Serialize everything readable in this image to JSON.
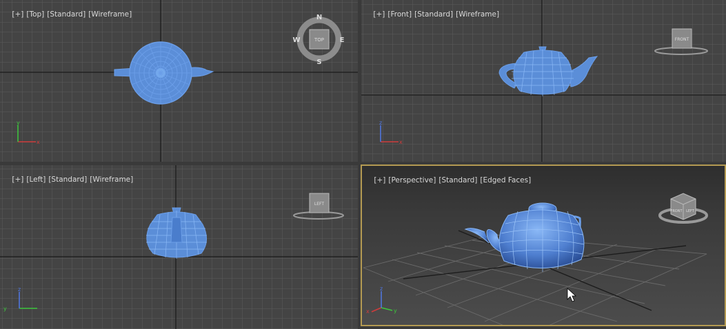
{
  "viewports": {
    "top": {
      "menu": "[+]",
      "view": "[Top]",
      "shading": "[Standard]",
      "mode": "[Wireframe]",
      "compass": {
        "n": "N",
        "s": "S",
        "e": "E",
        "w": "W",
        "cube": "TOP"
      },
      "axes": {
        "a": "x",
        "b": "y"
      }
    },
    "front": {
      "menu": "[+]",
      "view": "[Front]",
      "shading": "[Standard]",
      "mode": "[Wireframe]",
      "cube": "FRONT",
      "axes": {
        "a": "x",
        "b": "z"
      }
    },
    "left": {
      "menu": "[+]",
      "view": "[Left]",
      "shading": "[Standard]",
      "mode": "[Wireframe]",
      "cube": "LEFT",
      "axes": {
        "a": "y",
        "b": "z"
      }
    },
    "perspective": {
      "menu": "[+]",
      "view": "[Perspective]",
      "shading": "[Standard]",
      "mode": "[Edged Faces]",
      "cube": {
        "front": "FRONT",
        "left": "LEFT"
      },
      "axes": {
        "a": "x",
        "b": "y",
        "c": "z"
      }
    }
  },
  "colors": {
    "wire": "#6b9ee8",
    "grid": "#5a5a5a",
    "active_border": "#b49a52",
    "axis_x": "#d23c3c",
    "axis_y": "#3cc83c",
    "axis_z": "#5078e6"
  }
}
